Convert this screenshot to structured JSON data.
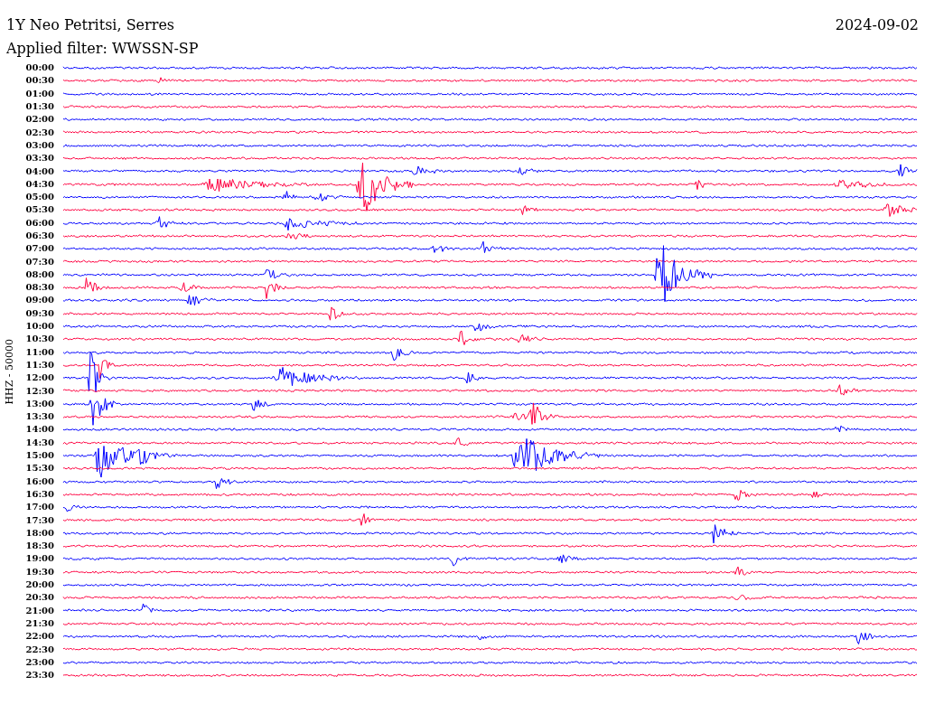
{
  "header": {
    "station": "1Y Neo Petritsi, Serres",
    "date": "2024-09-02",
    "filter": "Applied filter: WWSSN-SP"
  },
  "y_axis_label": "HHZ - 50000",
  "rows": [
    {
      "time": "00:00",
      "color": "#0000ff"
    },
    {
      "time": "00:30",
      "color": "#ff0040"
    },
    {
      "time": "01:00",
      "color": "#0000ff"
    },
    {
      "time": "01:30",
      "color": "#ff0040"
    },
    {
      "time": "02:00",
      "color": "#0000ff"
    },
    {
      "time": "02:30",
      "color": "#ff0040"
    },
    {
      "time": "03:00",
      "color": "#0000ff"
    },
    {
      "time": "03:30",
      "color": "#ff0040"
    },
    {
      "time": "04:00",
      "color": "#0000ff"
    },
    {
      "time": "04:30",
      "color": "#ff0040"
    },
    {
      "time": "05:00",
      "color": "#0000ff"
    },
    {
      "time": "05:30",
      "color": "#ff0040"
    },
    {
      "time": "06:00",
      "color": "#0000ff"
    },
    {
      "time": "06:30",
      "color": "#ff0040"
    },
    {
      "time": "07:00",
      "color": "#0000ff"
    },
    {
      "time": "07:30",
      "color": "#ff0040"
    },
    {
      "time": "08:00",
      "color": "#0000ff"
    },
    {
      "time": "08:30",
      "color": "#ff0040"
    },
    {
      "time": "09:00",
      "color": "#0000ff"
    },
    {
      "time": "09:30",
      "color": "#ff0040"
    },
    {
      "time": "10:00",
      "color": "#0000ff"
    },
    {
      "time": "10:30",
      "color": "#ff0040"
    },
    {
      "time": "11:00",
      "color": "#0000ff"
    },
    {
      "time": "11:30",
      "color": "#ff0040"
    },
    {
      "time": "12:00",
      "color": "#0000ff"
    },
    {
      "time": "12:30",
      "color": "#ff0040"
    },
    {
      "time": "13:00",
      "color": "#0000ff"
    },
    {
      "time": "13:30",
      "color": "#ff0040"
    },
    {
      "time": "14:00",
      "color": "#0000ff"
    },
    {
      "time": "14:30",
      "color": "#ff0040"
    },
    {
      "time": "15:00",
      "color": "#0000ff"
    },
    {
      "time": "15:30",
      "color": "#ff0040"
    },
    {
      "time": "16:00",
      "color": "#0000ff"
    },
    {
      "time": "16:30",
      "color": "#ff0040"
    },
    {
      "time": "17:00",
      "color": "#0000ff"
    },
    {
      "time": "17:30",
      "color": "#ff0040"
    },
    {
      "time": "18:00",
      "color": "#0000ff"
    },
    {
      "time": "18:30",
      "color": "#ff0040"
    },
    {
      "time": "19:00",
      "color": "#0000ff"
    },
    {
      "time": "19:30",
      "color": "#ff0040"
    },
    {
      "time": "20:00",
      "color": "#0000ff"
    },
    {
      "time": "20:30",
      "color": "#ff0040"
    },
    {
      "time": "21:00",
      "color": "#0000ff"
    },
    {
      "time": "21:30",
      "color": "#ff0040"
    },
    {
      "time": "22:00",
      "color": "#0000ff"
    },
    {
      "time": "22:30",
      "color": "#ff0040"
    },
    {
      "time": "23:00",
      "color": "#0000ff"
    },
    {
      "time": "23:30",
      "color": "#ff0040"
    }
  ]
}
